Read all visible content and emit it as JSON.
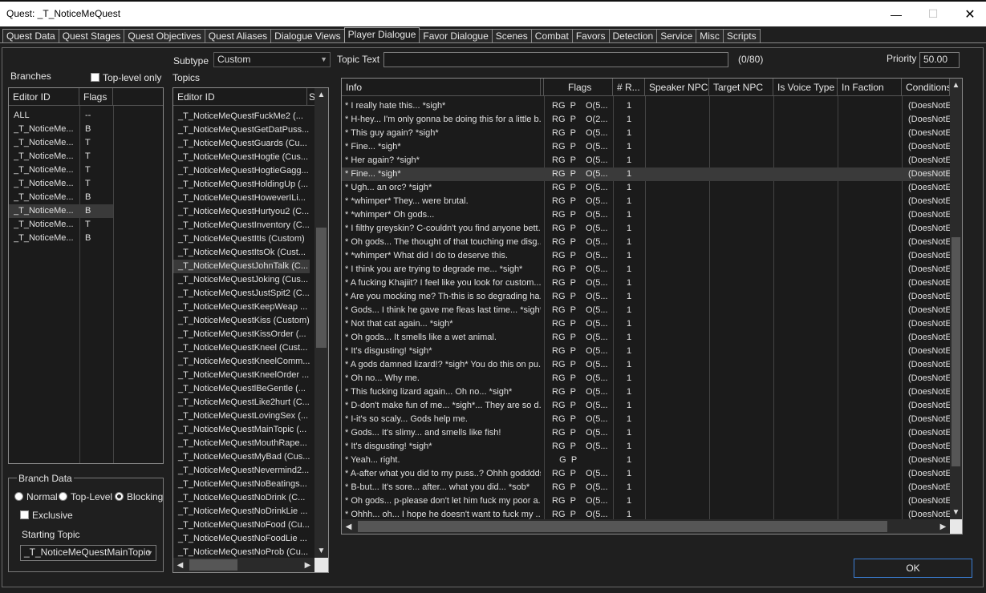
{
  "window": {
    "title": "Quest: _T_NoticeMeQuest",
    "minimize": "—",
    "maximize": "☐",
    "close": "✕"
  },
  "tabs": [
    "Quest Data",
    "Quest Stages",
    "Quest Objectives",
    "Quest Aliases",
    "Dialogue Views",
    "Player Dialogue",
    "Favor Dialogue",
    "Scenes",
    "Combat",
    "Favors",
    "Detection",
    "Service",
    "Misc",
    "Scripts"
  ],
  "active_tab": "Player Dialogue",
  "top": {
    "subtype_label": "Subtype",
    "subtype_value": "Custom",
    "topic_text_label": "Topic Text",
    "topic_text_value": "",
    "topic_text_count": "(0/80)",
    "priority_label": "Priority",
    "priority_value": "50.00"
  },
  "branches": {
    "label": "Branches",
    "toplevel_only": "Top-level only",
    "columns": [
      "Editor ID",
      "Flags"
    ],
    "rows": [
      [
        "ALL",
        "--"
      ],
      [
        "_T_NoticeMe...",
        "B"
      ],
      [
        "_T_NoticeMe...",
        "T"
      ],
      [
        "_T_NoticeMe...",
        "T"
      ],
      [
        "_T_NoticeMe...",
        "T"
      ],
      [
        "_T_NoticeMe...",
        "T"
      ],
      [
        "_T_NoticeMe...",
        "B"
      ],
      [
        "_T_NoticeMe...",
        "B"
      ],
      [
        "_T_NoticeMe...",
        "T"
      ],
      [
        "_T_NoticeMe...",
        "B"
      ]
    ],
    "selected_index": 7
  },
  "branch_data": {
    "label": "Branch Data",
    "normal": "Normal",
    "top_level": "Top-Level",
    "blocking": "Blocking",
    "exclusive": "Exclusive",
    "starting_topic_label": "Starting Topic",
    "starting_topic_value": "_T_NoticeMeQuestMainTopic"
  },
  "topics": {
    "label": "Topics",
    "column": "Editor ID",
    "column2": "S",
    "rows": [
      "_T_NoticeMeQuestFuckMe2 (...",
      "_T_NoticeMeQuestGetDatPuss...",
      "_T_NoticeMeQuestGuards (Cu...",
      "_T_NoticeMeQuestHogtie (Cus...",
      "_T_NoticeMeQuestHogtieGagg...",
      "_T_NoticeMeQuestHoldingUp (...",
      "_T_NoticeMeQuestHoweverILi...",
      "_T_NoticeMeQuestHurtyou2 (C...",
      "_T_NoticeMeQuestInventory (C...",
      "_T_NoticeMeQuestItIs (Custom)",
      "_T_NoticeMeQuestItsOk (Cust...",
      "_T_NoticeMeQuestJohnTalk (C...",
      "_T_NoticeMeQuestJoking (Cus...",
      "_T_NoticeMeQuestJustSpit2 (C...",
      "_T_NoticeMeQuestKeepWeap ...",
      "_T_NoticeMeQuestKiss (Custom)",
      "_T_NoticeMeQuestKissOrder (...",
      "_T_NoticeMeQuestKneel (Cust...",
      "_T_NoticeMeQuestKneelComm...",
      "_T_NoticeMeQuestKneelOrder ...",
      "_T_NoticeMeQuestlBeGentle (...",
      "_T_NoticeMeQuestLike2hurt (C...",
      "_T_NoticeMeQuestLovingSex (...",
      "_T_NoticeMeQuestMainTopic (...",
      "_T_NoticeMeQuestMouthRape...",
      "_T_NoticeMeQuestMyBad (Cus...",
      "_T_NoticeMeQuestNevermind2...",
      "_T_NoticeMeQuestNoBeatings...",
      "_T_NoticeMeQuestNoDrink (C...",
      "_T_NoticeMeQuestNoDrinkLie ...",
      "_T_NoticeMeQuestNoFood (Cu...",
      "_T_NoticeMeQuestNoFoodLie ...",
      "_T_NoticeMeQuestNoProb (Cu..."
    ],
    "selected_index": 11
  },
  "info": {
    "columns": [
      "Info",
      "Flags",
      "# R...",
      "Speaker NPC",
      "Target NPC",
      "Is Voice Type",
      "In Faction",
      "Conditions"
    ],
    "rows": [
      [
        "* I really hate this... *sigh*",
        "RG  P",
        "O(5...",
        "1",
        "(DoesNotE"
      ],
      [
        "* H-hey... I'm only gonna be doing this for a little b...",
        "RG  P",
        "O(2...",
        "1",
        "(DoesNotE"
      ],
      [
        "* This guy again? *sigh*",
        "RG  P",
        "O(5...",
        "1",
        "(DoesNotE"
      ],
      [
        "* Fine... *sigh*",
        "RG  P",
        "O(5...",
        "1",
        "(DoesNotE"
      ],
      [
        "* Her again? *sigh*",
        "RG  P",
        "O(5...",
        "1",
        "(DoesNotE"
      ],
      [
        "* Fine... *sigh*",
        "RG  P",
        "O(5...",
        "1",
        "(DoesNotE"
      ],
      [
        "* Ugh... an orc? *sigh*",
        "RG  P",
        "O(5...",
        "1",
        "(DoesNotE"
      ],
      [
        "* *whimper* They... were brutal.",
        "RG  P",
        "O(5...",
        "1",
        "(DoesNotE"
      ],
      [
        "* *whimper* Oh gods...",
        "RG  P",
        "O(5...",
        "1",
        "(DoesNotE"
      ],
      [
        "* I filthy greyskin? C-couldn't you find anyone bett...",
        "RG  P",
        "O(5...",
        "1",
        "(DoesNotE"
      ],
      [
        "* Oh gods... The thought of that touching me disg...",
        "RG  P",
        "O(5...",
        "1",
        "(DoesNotE"
      ],
      [
        "* *whimper* What did I do to deserve this.",
        "RG  P",
        "O(5...",
        "1",
        "(DoesNotE"
      ],
      [
        "* I think you are trying to degrade me... *sigh*",
        "RG  P",
        "O(5...",
        "1",
        "(DoesNotE"
      ],
      [
        "* A fucking Khajiit? I feel like you look for custom...",
        "RG  P",
        "O(5...",
        "1",
        "(DoesNotE"
      ],
      [
        "* Are you mocking me? Th-this is so degrading ha...",
        "RG  P",
        "O(5...",
        "1",
        "(DoesNotE"
      ],
      [
        "* Gods... I think he gave me fleas last time... *sigh*.",
        "RG  P",
        "O(5...",
        "1",
        "(DoesNotE"
      ],
      [
        "* Not that cat again... *sigh*",
        "RG  P",
        "O(5...",
        "1",
        "(DoesNotE"
      ],
      [
        "* Oh gods... It smells like a wet animal.",
        "RG  P",
        "O(5...",
        "1",
        "(DoesNotE"
      ],
      [
        "* It's disgusting! *sigh*",
        "RG  P",
        "O(5...",
        "1",
        "(DoesNotE"
      ],
      [
        "* A gods damned lizard!? *sigh* You do this on pu...",
        "RG  P",
        "O(5...",
        "1",
        "(DoesNotE"
      ],
      [
        "* Oh no... Why me.",
        "RG  P",
        "O(5...",
        "1",
        "(DoesNotE"
      ],
      [
        "* This fucking lizard again... Oh no... *sigh*",
        "RG  P",
        "O(5...",
        "1",
        "(DoesNotE"
      ],
      [
        "* D-don't make fun of me... *sigh*... They are so d...",
        "RG  P",
        "O(5...",
        "1",
        "(DoesNotE"
      ],
      [
        "* I-it's so scaly... Gods help me.",
        "RG  P",
        "O(5...",
        "1",
        "(DoesNotE"
      ],
      [
        "* Gods... It's slimy... and smells like fish!",
        "RG  P",
        "O(5...",
        "1",
        "(DoesNotE"
      ],
      [
        "* It's disgusting! *sigh*",
        "RG  P",
        "O(5...",
        "1",
        "(DoesNotE"
      ],
      [
        "* Yeah... right.",
        "   G  P",
        "",
        "1",
        "(DoesNotE"
      ],
      [
        "* A-after what you did to my puss..? Ohhh godddds...",
        "RG  P",
        "O(5...",
        "1",
        "(DoesNotE"
      ],
      [
        "* B-but... It's sore... after... what you did... *sob*",
        "RG  P",
        "O(5...",
        "1",
        "(DoesNotE"
      ],
      [
        "* Oh gods... p-please don't let him fuck my poor a...",
        "RG  P",
        "O(5...",
        "1",
        "(DoesNotE"
      ],
      [
        "* Ohhh... oh... I hope he doesn't want to fuck my ...",
        "RG  P",
        "O(5...",
        "1",
        "(DoesNotE"
      ]
    ],
    "selected_index": 5
  },
  "ok_button": "OK"
}
